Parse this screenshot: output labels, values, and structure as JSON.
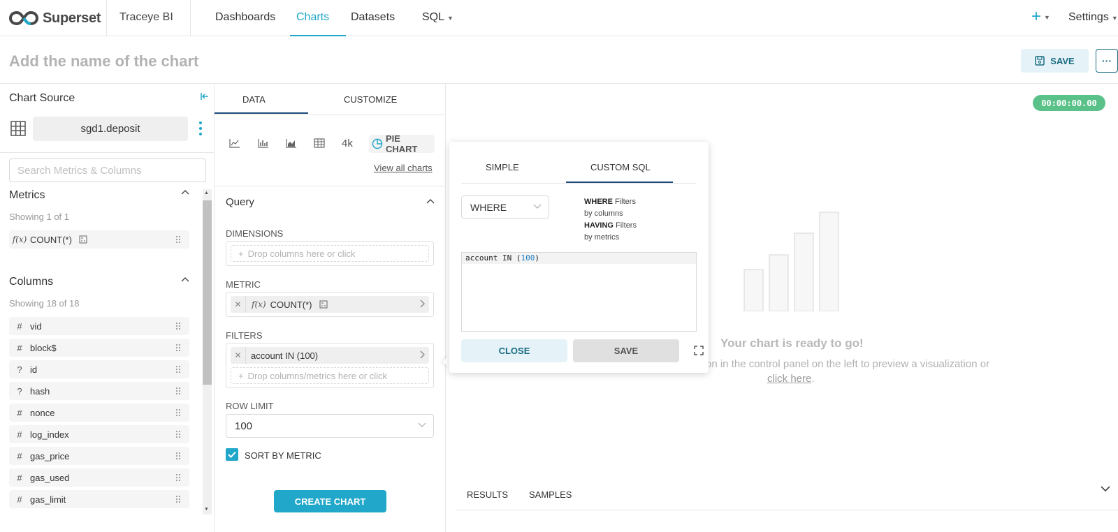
{
  "nav": {
    "brand": "Superset",
    "org": "Traceye BI",
    "items": [
      "Dashboards",
      "Charts",
      "Datasets",
      "SQL"
    ],
    "active_item": "Charts",
    "settings": "Settings"
  },
  "header": {
    "chart_name_placeholder": "Add the name of the chart",
    "save_label": "SAVE"
  },
  "left_panel": {
    "title": "Chart Source",
    "dataset": "sgd1.deposit",
    "search_placeholder": "Search Metrics & Columns",
    "metrics": {
      "title": "Metrics",
      "showing": "Showing 1 of 1",
      "items": [
        {
          "type": "f(x)",
          "name": "COUNT(*)"
        }
      ]
    },
    "columns": {
      "title": "Columns",
      "showing": "Showing 18 of 18",
      "items": [
        {
          "type": "#",
          "name": "vid"
        },
        {
          "type": "#",
          "name": "block$"
        },
        {
          "type": "?",
          "name": "id"
        },
        {
          "type": "?",
          "name": "hash"
        },
        {
          "type": "#",
          "name": "nonce"
        },
        {
          "type": "#",
          "name": "log_index"
        },
        {
          "type": "#",
          "name": "gas_price"
        },
        {
          "type": "#",
          "name": "gas_used"
        },
        {
          "type": "#",
          "name": "gas_limit"
        }
      ]
    }
  },
  "mid_panel": {
    "tabs": [
      "DATA",
      "CUSTOMIZE"
    ],
    "viz_4k": "4k",
    "viz_selected": "PIE CHART",
    "view_all": "View all charts",
    "query_title": "Query",
    "dimensions_label": "DIMENSIONS",
    "dimensions_placeholder": "Drop columns here or click",
    "metric_label": "METRIC",
    "metric_fx": "f(x)",
    "metric_value": "COUNT(*)",
    "filters_label": "FILTERS",
    "filter_value": "account IN (100)",
    "filters_placeholder": "Drop columns/metrics here or click",
    "row_limit_label": "ROW LIMIT",
    "row_limit_value": "100",
    "sort_by_metric": "SORT BY METRIC",
    "create_chart": "CREATE CHART"
  },
  "right_panel": {
    "timer": "00:00:00.00",
    "ready_title": "Your chart is ready to go!",
    "ready_desc": "on in the control panel on the left to preview a visualization or",
    "click_here": "click here",
    "period": ".",
    "results_tabs": [
      "RESULTS",
      "SAMPLES"
    ]
  },
  "popover": {
    "tabs": [
      "SIMPLE",
      "CUSTOM SQL"
    ],
    "clause": "WHERE",
    "help": {
      "where_bold": "WHERE",
      "where_rest": " Filters",
      "where_line2": "by columns",
      "having_bold": "HAVING",
      "having_rest": " Filters",
      "having_line2": "by metrics"
    },
    "sql_prefix": "account IN (",
    "sql_number": "100",
    "sql_suffix": ")",
    "close_label": "CLOSE",
    "save_label": "SAVE"
  },
  "colors": {
    "primary": "#20a7c9",
    "primary_dark": "#1a6b82",
    "timer_green": "#5ac189"
  }
}
